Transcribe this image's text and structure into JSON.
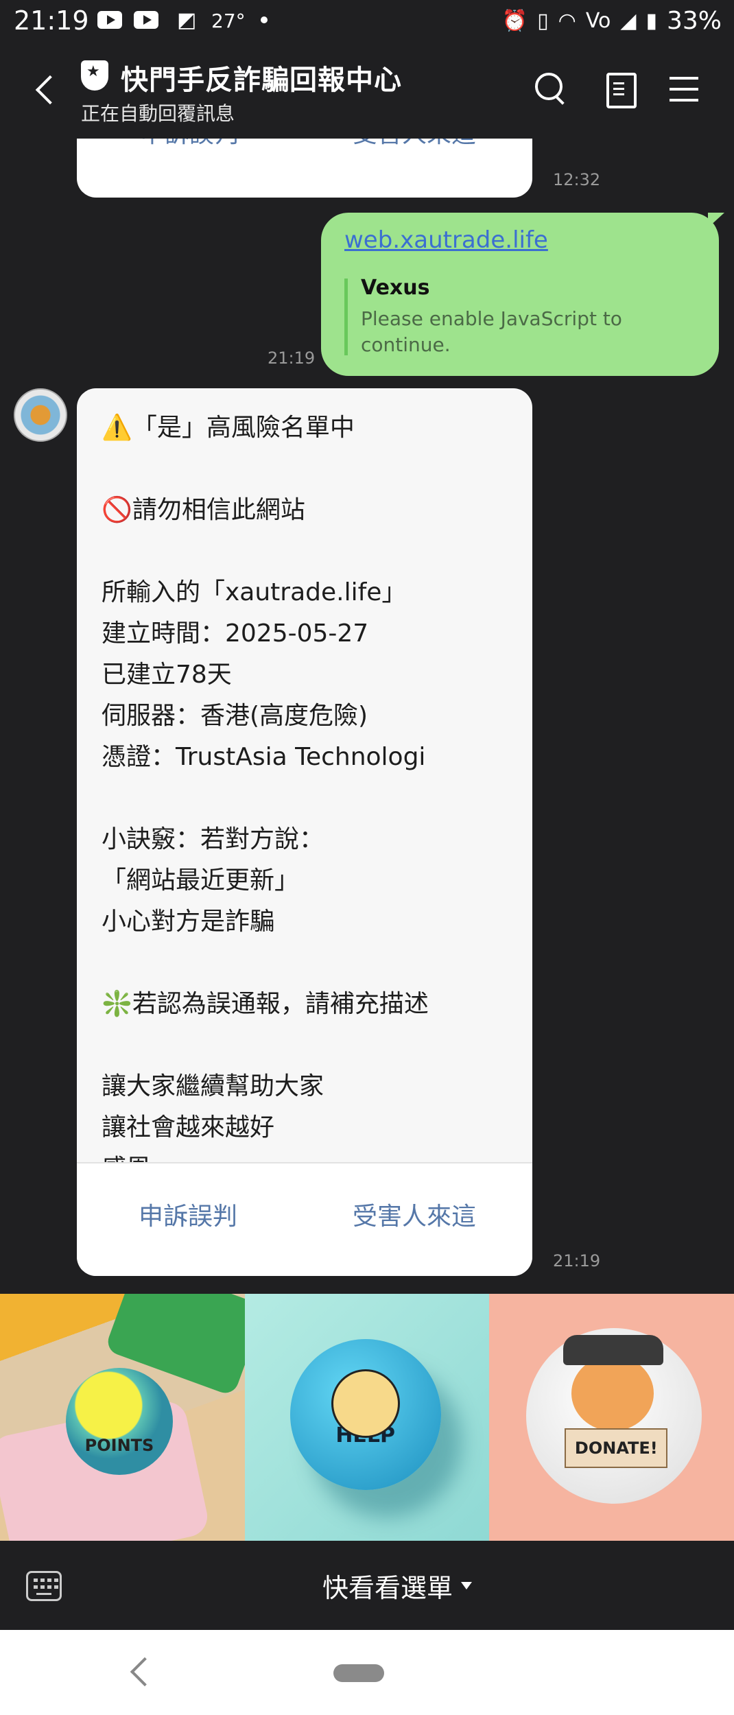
{
  "status_bar": {
    "time": "21:19",
    "weather_temp": "27°",
    "battery": "33%",
    "icons": [
      "youtube-icon",
      "youtube-icon",
      "note-icon",
      "alarm-icon",
      "vibrate-icon",
      "wifi-icon",
      "volte-icon",
      "signal-icon",
      "battery-icon"
    ]
  },
  "header": {
    "title": "快門手反詐騙回報中心",
    "subtitle": "正在自動回覆訊息"
  },
  "chat": {
    "previous_card": {
      "button_left": "申訴誤判",
      "button_right": "受害人來這",
      "time": "12:32"
    },
    "outgoing": {
      "link": "web.xautrade.life",
      "preview_title": "Vexus",
      "preview_desc": "Please enable JavaScript to continue.",
      "time": "21:19"
    },
    "reply_card": {
      "text": "⚠️「是」高風險名單中\n\n🚫請勿相信此網站\n\n所輸入的「xautrade.life」\n建立時間：2025-05-27\n已建立78天\n伺服器：香港(高度危險)\n憑證：TrustAsia Technologi\n\n小訣竅：若對方說：\n「網站最近更新」\n小心對方是詐騙\n\n❇️若認為誤通報，請補充描述\n\n讓大家繼續幫助大家\n讓社會越來越好\n感恩",
      "button_left": "申訴誤判",
      "button_right": "受害人來這",
      "time": "21:19"
    }
  },
  "rich_menu": {
    "tiles": [
      {
        "label": "POINTS"
      },
      {
        "label": "HELP"
      },
      {
        "label": "DONATE!"
      }
    ]
  },
  "menu_bar": {
    "label": "快看看選單"
  },
  "colors": {
    "background": "#1f1f21",
    "outgoing_bubble": "#9ee38d",
    "link": "#3b6fd1",
    "card_button": "#5577a8"
  }
}
